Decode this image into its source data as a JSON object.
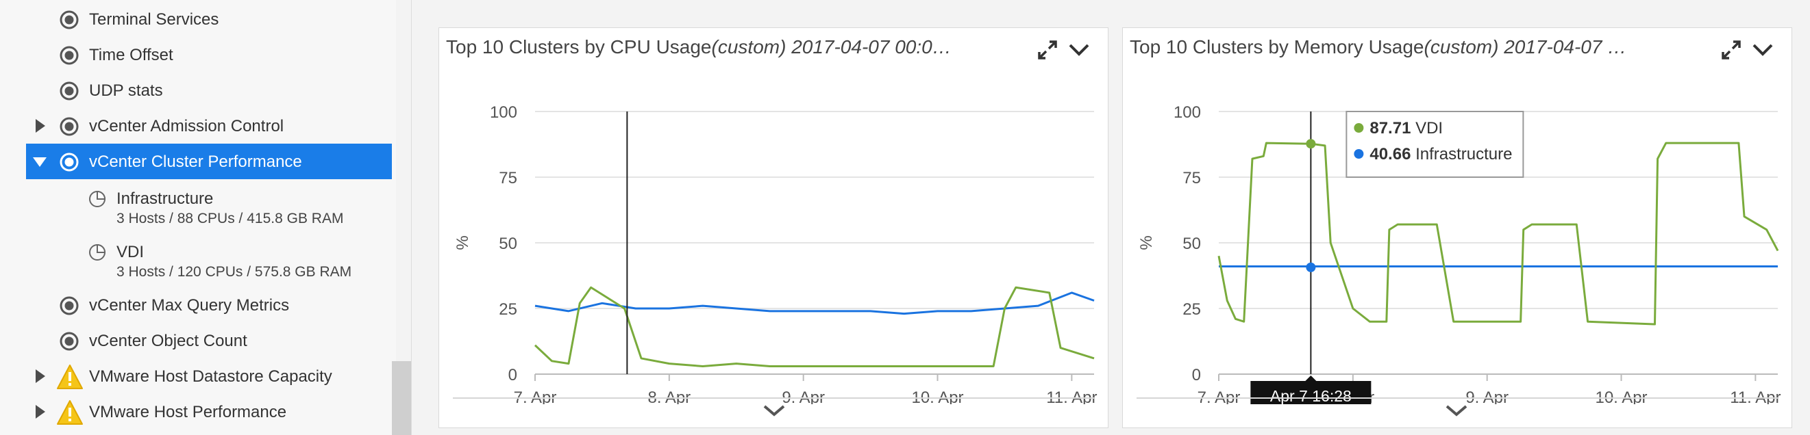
{
  "sidebar": {
    "items": [
      {
        "label": "Terminal Services",
        "status": "monitor"
      },
      {
        "label": "Time Offset",
        "status": "monitor"
      },
      {
        "label": "UDP stats",
        "status": "monitor"
      },
      {
        "label": "vCenter Admission Control",
        "status": "monitor",
        "expander": "collapsed"
      },
      {
        "label": "vCenter Cluster Performance",
        "status": "monitor",
        "expander": "expanded",
        "selected": true
      },
      {
        "label": "Infrastructure",
        "detail": "3 Hosts / 88 CPUs / 415.8 GB RAM",
        "status": "instance"
      },
      {
        "label": "VDI",
        "detail": "3 Hosts / 120 CPUs / 575.8 GB RAM",
        "status": "instance"
      },
      {
        "label": "vCenter Max Query Metrics",
        "status": "monitor"
      },
      {
        "label": "vCenter Object Count",
        "status": "monitor"
      },
      {
        "label": "VMware Host Datastore Capacity",
        "status": "warning",
        "expander": "collapsed"
      },
      {
        "label": "VMware Host Performance",
        "status": "warning",
        "expander": "collapsed"
      }
    ]
  },
  "panels": [
    {
      "title_main": "Top 10 Clusters by CPU Usage",
      "title_italic": "(custom) 2017-04-07 00:0…",
      "icons": [
        "expand-icon",
        "chevron-down-icon"
      ]
    },
    {
      "title_main": "Top 10 Clusters by Memory Usage",
      "title_italic": "(custom) 2017-04-07 …",
      "icons": [
        "expand-icon",
        "chevron-down-icon"
      ]
    }
  ],
  "colors": {
    "vdi": "#7aab3c",
    "infrastructure": "#1a73e0",
    "selected": "#1a7de8",
    "warning": "#f5c518"
  },
  "chart_data": [
    {
      "type": "line",
      "title": "Top 10 Clusters by CPU Usage(custom) 2017-04-07 00:0…",
      "ylabel": "%",
      "ylim": [
        0,
        100
      ],
      "yticks": [
        "0",
        "25",
        "50",
        "75",
        "100"
      ],
      "x_range_days": [
        "2017-04-07T00:00",
        "2017-04-11T04:00"
      ],
      "xtick_labels": [
        "7. Apr",
        "8. Apr",
        "9. Apr",
        "10. Apr",
        "11. Apr"
      ],
      "grid": true,
      "cursor_x": "2017-04-07T16:28",
      "series": [
        {
          "key": "infrastructure",
          "color": "#1a73e0",
          "points": [
            [
              "2017-04-07T00:00",
              26
            ],
            [
              "2017-04-07T06:00",
              24
            ],
            [
              "2017-04-07T12:00",
              27
            ],
            [
              "2017-04-07T18:00",
              25
            ],
            [
              "2017-04-08T00:00",
              25
            ],
            [
              "2017-04-08T06:00",
              26
            ],
            [
              "2017-04-08T12:00",
              25
            ],
            [
              "2017-04-08T18:00",
              24
            ],
            [
              "2017-04-09T00:00",
              24
            ],
            [
              "2017-04-09T06:00",
              24
            ],
            [
              "2017-04-09T12:00",
              24
            ],
            [
              "2017-04-09T18:00",
              23
            ],
            [
              "2017-04-10T00:00",
              24
            ],
            [
              "2017-04-10T06:00",
              24
            ],
            [
              "2017-04-10T12:00",
              25
            ],
            [
              "2017-04-10T18:00",
              26
            ],
            [
              "2017-04-11T00:00",
              31
            ],
            [
              "2017-04-11T04:00",
              28
            ]
          ]
        },
        {
          "key": "vdi",
          "color": "#7aab3c",
          "points": [
            [
              "2017-04-07T00:00",
              11
            ],
            [
              "2017-04-07T03:00",
              5
            ],
            [
              "2017-04-07T06:00",
              4
            ],
            [
              "2017-04-07T08:00",
              27
            ],
            [
              "2017-04-07T10:00",
              33
            ],
            [
              "2017-04-07T13:00",
              29
            ],
            [
              "2017-04-07T16:00",
              25
            ],
            [
              "2017-04-07T19:00",
              6
            ],
            [
              "2017-04-08T00:00",
              4
            ],
            [
              "2017-04-08T06:00",
              3
            ],
            [
              "2017-04-08T12:00",
              4
            ],
            [
              "2017-04-08T18:00",
              3
            ],
            [
              "2017-04-09T00:00",
              3
            ],
            [
              "2017-04-09T06:00",
              3
            ],
            [
              "2017-04-09T12:00",
              3
            ],
            [
              "2017-04-09T18:00",
              3
            ],
            [
              "2017-04-10T00:00",
              3
            ],
            [
              "2017-04-10T06:00",
              3
            ],
            [
              "2017-04-10T10:00",
              3
            ],
            [
              "2017-04-10T12:00",
              25
            ],
            [
              "2017-04-10T14:00",
              33
            ],
            [
              "2017-04-10T20:00",
              31
            ],
            [
              "2017-04-10T22:00",
              10
            ],
            [
              "2017-04-11T04:00",
              6
            ]
          ]
        }
      ]
    },
    {
      "type": "line",
      "title": "Top 10 Clusters by Memory Usage(custom) 2017-04-07 …",
      "ylabel": "%",
      "ylim": [
        0,
        100
      ],
      "yticks": [
        "0",
        "25",
        "50",
        "75",
        "100"
      ],
      "x_range_days": [
        "2017-04-07T00:00",
        "2017-04-11T04:00"
      ],
      "xtick_labels": [
        "7. Apr",
        "8. Apr",
        "9. Apr",
        "10. Apr",
        "11. Apr"
      ],
      "grid": true,
      "cursor_x": "2017-04-07T16:28",
      "cursor_label": "Apr 7 16:28",
      "tooltip": [
        {
          "key": "vdi",
          "value": "87.71",
          "name": "VDI"
        },
        {
          "key": "infrastructure",
          "value": "40.66",
          "name": "Infrastructure"
        }
      ],
      "series": [
        {
          "key": "infrastructure",
          "color": "#1a73e0",
          "points": [
            [
              "2017-04-07T00:00",
              41
            ],
            [
              "2017-04-11T04:00",
              41
            ]
          ]
        },
        {
          "key": "vdi",
          "color": "#7aab3c",
          "points": [
            [
              "2017-04-07T00:00",
              45
            ],
            [
              "2017-04-07T01:30",
              28
            ],
            [
              "2017-04-07T03:00",
              21
            ],
            [
              "2017-04-07T04:30",
              20
            ],
            [
              "2017-04-07T06:00",
              82
            ],
            [
              "2017-04-07T08:00",
              83
            ],
            [
              "2017-04-07T08:30",
              88
            ],
            [
              "2017-04-07T16:28",
              87.71
            ],
            [
              "2017-04-07T19:00",
              87
            ],
            [
              "2017-04-07T20:00",
              50
            ],
            [
              "2017-04-08T00:00",
              25
            ],
            [
              "2017-04-08T03:00",
              20
            ],
            [
              "2017-04-08T06:00",
              20
            ],
            [
              "2017-04-08T06:30",
              55
            ],
            [
              "2017-04-08T08:00",
              57
            ],
            [
              "2017-04-08T15:00",
              57
            ],
            [
              "2017-04-08T18:00",
              20
            ],
            [
              "2017-04-09T06:00",
              20
            ],
            [
              "2017-04-09T06:30",
              55
            ],
            [
              "2017-04-09T08:00",
              57
            ],
            [
              "2017-04-09T16:00",
              57
            ],
            [
              "2017-04-09T18:00",
              20
            ],
            [
              "2017-04-10T06:00",
              19
            ],
            [
              "2017-04-10T06:30",
              82
            ],
            [
              "2017-04-10T08:00",
              88
            ],
            [
              "2017-04-10T21:00",
              88
            ],
            [
              "2017-04-10T22:00",
              60
            ],
            [
              "2017-04-11T02:00",
              55
            ],
            [
              "2017-04-11T04:00",
              47
            ]
          ]
        }
      ]
    }
  ]
}
